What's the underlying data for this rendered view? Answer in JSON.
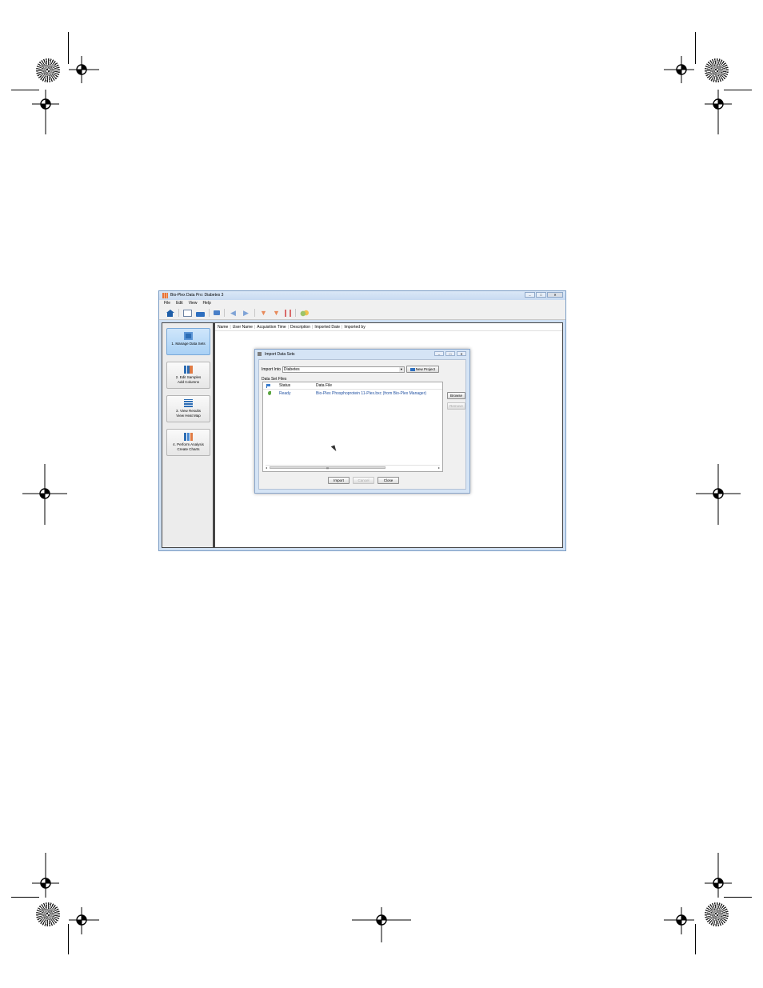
{
  "window": {
    "title": "Bio-Plex Data Pro: Diabetes 3",
    "controls": {
      "minimize": "–",
      "maximize": "□",
      "close": "✕"
    }
  },
  "menu": {
    "items": [
      "File",
      "Edit",
      "View",
      "Help"
    ]
  },
  "toolbar": {
    "icons": [
      "home-icon",
      "new-project-icon",
      "open-folder-icon",
      "export-icon",
      "back-arrow-icon",
      "forward-arrow-icon",
      "filter-down-icon",
      "filter-remove-icon",
      "bar-icon",
      "overlay-circles-icon"
    ]
  },
  "sidebar": {
    "items": [
      {
        "line1": "1. Manage Data Sets",
        "line2": "",
        "active": true,
        "icon": "manage-data-sets-icon"
      },
      {
        "line1": "2. Edit Samples",
        "line2": "Add Columns",
        "active": false,
        "icon": "edit-samples-icon"
      },
      {
        "line1": "3. View Results",
        "line2": "View Heat Map",
        "active": false,
        "icon": "view-results-icon"
      },
      {
        "line1": "4. Perform Analysis",
        "line2": "Create Charts",
        "active": false,
        "icon": "perform-analysis-icon"
      }
    ]
  },
  "columns": [
    "Name",
    "User Name",
    "Acquisition Time",
    "Description",
    "Imported Date",
    "Imported by"
  ],
  "dialog": {
    "title": "Import Data Sets",
    "controls": {
      "minimize": "–",
      "maximize": "□",
      "close": "✕"
    },
    "import_into_label": "Import Into",
    "import_into_value": "Diabetes",
    "new_project_label": "New Project",
    "files_label": "Data Set Files",
    "table_headers": {
      "status": "Status",
      "file": "Data File"
    },
    "rows": [
      {
        "status": "Ready",
        "file": "Bio-Plex Phosphoprotein 11-Plex.bxc (from Bio-Plex Manager)"
      }
    ],
    "browse_label": "Browse",
    "remove_label": "Remove",
    "import_label": "Import",
    "cancel_label": "Cancel",
    "close_label": "Close"
  },
  "colors": {
    "window_frame": "#cfe0f3",
    "active_nav": "#a9d1f5",
    "icon_blue": "#2d6db4",
    "link_blue": "#1f4fa0"
  }
}
